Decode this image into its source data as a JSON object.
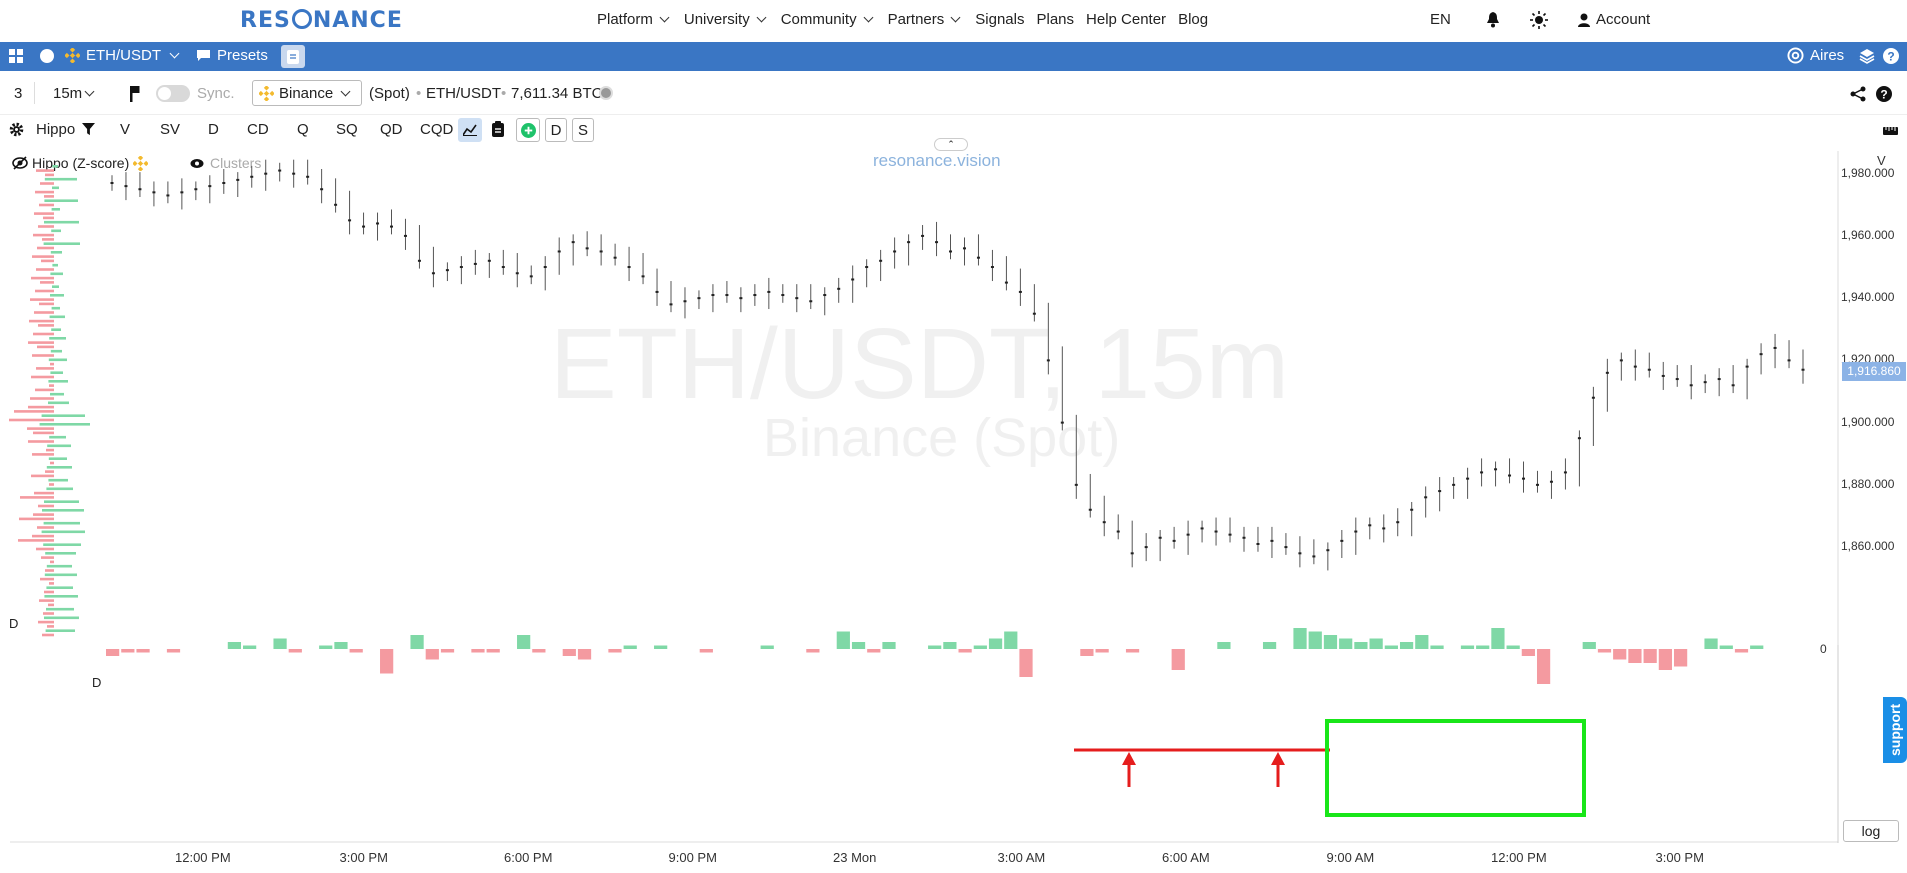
{
  "nav": {
    "logo": "RES NANCE",
    "menu": [
      "Platform",
      "University",
      "Community",
      "Partners",
      "Signals",
      "Plans",
      "Help Center",
      "Blog"
    ],
    "menu_has_chevron": [
      true,
      true,
      true,
      true,
      false,
      false,
      false,
      false
    ],
    "lang": "EN",
    "account": "Account"
  },
  "toolbar": {
    "symbol": "ETH/USDT",
    "presets": "Presets",
    "user": "Aires"
  },
  "chart_bar": {
    "layout_count": "3",
    "timeframe": "15m",
    "sync": "Sync.",
    "exchange": "Binance",
    "market": "(Spot)",
    "pair": "ETH/USDT",
    "volume": "7,611.34 BTC"
  },
  "indicators": {
    "name": "Hippo",
    "buttons": [
      "V",
      "SV",
      "D",
      "CD",
      "Q",
      "SQ",
      "QD",
      "CQD"
    ],
    "extra": [
      "D",
      "S"
    ]
  },
  "legend": {
    "indicator_label": "Hippo (Z-score)",
    "clusters": "Clusters",
    "site": "resonance.vision",
    "panel_label": "D",
    "panel_label2": "D"
  },
  "watermark": {
    "line1": "ETH/USDT, 15m",
    "line2": "Binance (Spot)"
  },
  "axis": {
    "right_header": "V",
    "log_button": "log",
    "current_price": "1,916.860",
    "zero_label": "0"
  },
  "support_label": "support",
  "colors": {
    "accent": "#3a76c4",
    "bull": "#7fd8a6",
    "bear": "#f49aa0",
    "annotation_red": "#e51d1d",
    "annotation_green": "#19e619"
  },
  "chart_data": {
    "type": "candlestick",
    "y_ticks": [
      "1,860.000",
      "1,880.000",
      "1,900.000",
      "1,920.000",
      "1,940.000",
      "1,960.000",
      "1,980.000"
    ],
    "y_tick_values": [
      1860,
      1880,
      1900,
      1920,
      1940,
      1960,
      1980
    ],
    "x_ticks": [
      "12:00 PM",
      "3:00 PM",
      "6:00 PM",
      "9:00 PM",
      "23 Mon",
      "3:00 AM",
      "6:00 AM",
      "9:00 AM",
      "12:00 PM",
      "3:00 PM"
    ],
    "ylim": [
      1843,
      1986
    ],
    "closes": [
      1977,
      1976,
      1975,
      1974,
      1973,
      1974,
      1975,
      1976,
      1977,
      1978,
      1979,
      1980,
      1981,
      1980,
      1979,
      1975,
      1970,
      1965,
      1963,
      1964,
      1963,
      1960,
      1952,
      1948,
      1949,
      1950,
      1951,
      1952,
      1950,
      1948,
      1947,
      1950,
      1955,
      1958,
      1956,
      1955,
      1953,
      1950,
      1947,
      1942,
      1938,
      1939,
      1940,
      1941,
      1941,
      1940,
      1941,
      1942,
      1941,
      1940,
      1939,
      1941,
      1943,
      1946,
      1950,
      1952,
      1955,
      1958,
      1960,
      1958,
      1955,
      1956,
      1953,
      1950,
      1945,
      1942,
      1935,
      1920,
      1900,
      1880,
      1872,
      1868,
      1865,
      1858,
      1860,
      1863,
      1862,
      1864,
      1866,
      1865,
      1864,
      1863,
      1861,
      1862,
      1860,
      1858,
      1857,
      1859,
      1862,
      1865,
      1867,
      1866,
      1868,
      1872,
      1876,
      1878,
      1880,
      1882,
      1884,
      1885,
      1883,
      1882,
      1880,
      1881,
      1884,
      1895,
      1908,
      1916,
      1920,
      1918,
      1917,
      1915,
      1914,
      1912,
      1913,
      1914,
      1912,
      1918,
      1922,
      1924,
      1920,
      1917
    ],
    "delta_bars": [
      -1,
      -0.5,
      -0.5,
      0,
      -0.5,
      0,
      0,
      0,
      1,
      0.5,
      0,
      1.5,
      -0.5,
      0,
      0.5,
      1,
      -0.5,
      0,
      -3.5,
      0,
      2,
      -1.5,
      -0.5,
      0,
      -0.5,
      -0.5,
      0,
      2,
      -0.5,
      0,
      -1,
      -1.5,
      0,
      -0.5,
      0.5,
      0,
      0.5,
      0,
      0,
      -0.5,
      0,
      0,
      0,
      0.5,
      0,
      0,
      -0.5,
      0,
      2.5,
      1,
      -0.5,
      1,
      0,
      0,
      0.5,
      1,
      -0.5,
      0.5,
      1.5,
      2.5,
      -4,
      0,
      0,
      0,
      -1,
      -0.5,
      0,
      -0.5,
      0,
      0,
      -3,
      0,
      0,
      1,
      0,
      0,
      1,
      0,
      3,
      2.5,
      2,
      1.5,
      1,
      1.5,
      0.5,
      1,
      2,
      0.5,
      0,
      0.5,
      0.5,
      3,
      0.5,
      -1,
      -5,
      0,
      0,
      1,
      -0.5,
      -1.5,
      -2,
      -2,
      -3,
      -2.5,
      0,
      1.5,
      0.5,
      -0.5,
      0.5,
      0,
      0,
      0
    ]
  }
}
